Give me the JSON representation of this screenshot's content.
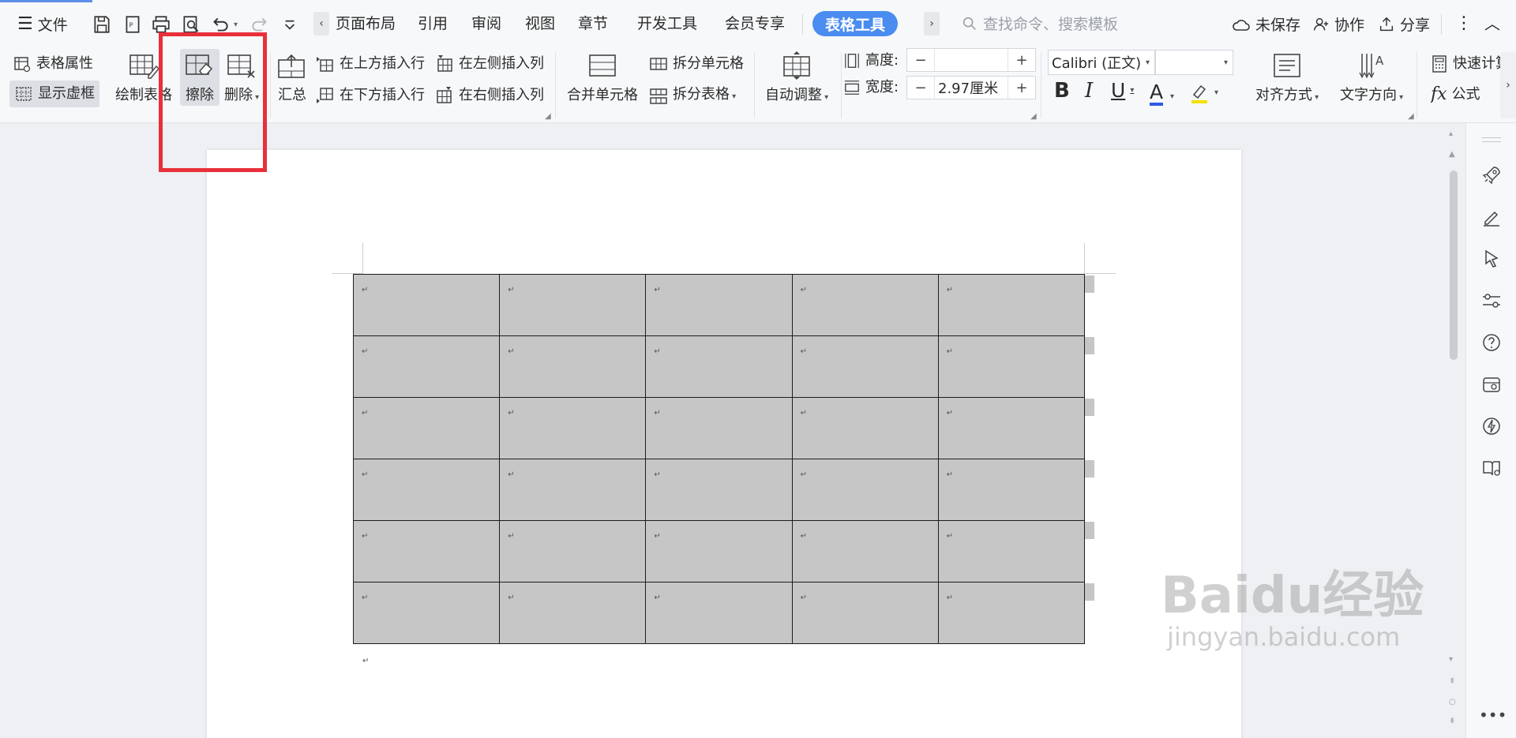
{
  "menubar": {
    "file_label": "文件",
    "tabs": [
      "页面布局",
      "引用",
      "审阅",
      "视图",
      "章节",
      "开发工具",
      "会员专享"
    ],
    "active_tab": "表格工具",
    "search_placeholder": "查找命令、搜索模板",
    "unsaved_label": "未保存",
    "collab_label": "协作",
    "share_label": "分享"
  },
  "ribbon": {
    "table_props": "表格属性",
    "show_grid": "显示虚框",
    "draw_table": "绘制表格",
    "erase": "擦除",
    "delete": "删除",
    "summary": "汇总",
    "insert_row_above": "在上方插入行",
    "insert_row_below": "在下方插入行",
    "insert_col_left": "在左侧插入列",
    "insert_col_right": "在右侧插入列",
    "merge_cells": "合并单元格",
    "split_cells": "拆分单元格",
    "split_table": "拆分表格",
    "auto_fit": "自动调整",
    "height_label": "高度:",
    "height_value": "",
    "width_label": "宽度:",
    "width_value": "2.97厘米",
    "font_name": "Calibri (正文)",
    "font_size": "",
    "align_label": "对齐方式",
    "text_direction_label": "文字方向",
    "quick_calc": "快速计算",
    "formula": "公式"
  },
  "table": {
    "rows": 6,
    "cols": 5,
    "cell_mark": "↵"
  },
  "colors": {
    "accent": "#4a8cf0",
    "highlight_box": "#e8303a",
    "cell_shading": "#c6c6c6"
  },
  "watermark": {
    "brand": "Baidu经验",
    "url": "jingyan.baidu.com"
  }
}
